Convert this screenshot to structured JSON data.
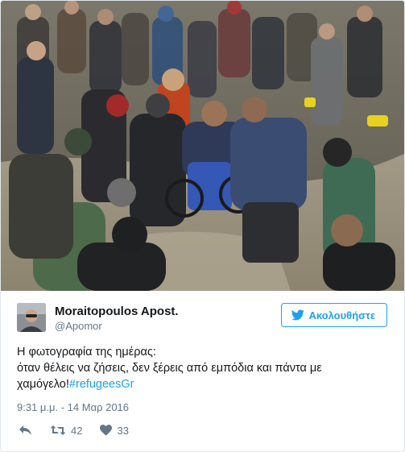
{
  "photo": {
    "description_icon": "photo-icon"
  },
  "author": {
    "name": "Moraitopoulos Apost.",
    "handle": "@Apomor",
    "avatar_icon": "avatar-icon"
  },
  "follow_button": {
    "label": "Ακολουθήστε",
    "icon": "twitter-bird-icon"
  },
  "tweet": {
    "line1": "Η φωτογραφία της ημέρας:",
    "line2": "όταν θέλεις να ζήσεις, δεν ξέρεις από εμπόδια και πάντα με",
    "line3_text": "χαμόγελο!",
    "hashtag": "#refugeesGr"
  },
  "timestamp": "9:31 μ.μ. - 14 Μαρ 2016",
  "actions": {
    "reply_icon": "reply-icon",
    "retweet_icon": "retweet-icon",
    "retweet_count": "42",
    "like_icon": "heart-icon",
    "like_count": "33"
  },
  "colors": {
    "accent": "#1da1f2",
    "text": "#14171a",
    "muted": "#657786",
    "border": "#e1e8ed"
  }
}
